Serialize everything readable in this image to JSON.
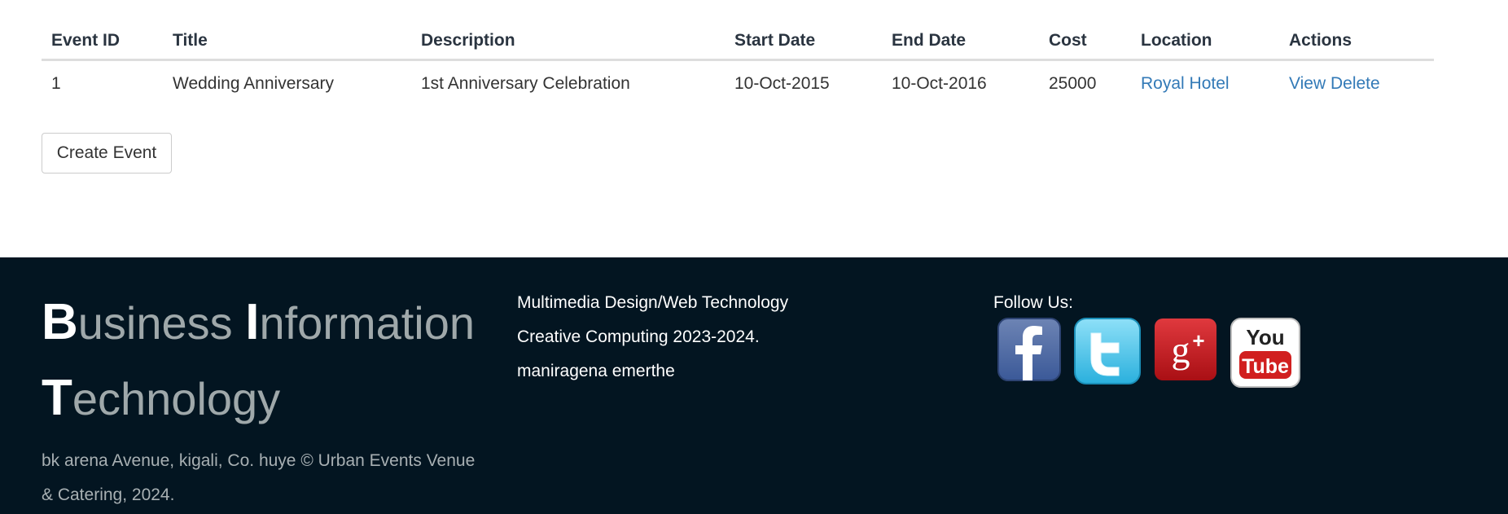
{
  "table": {
    "headers": [
      "Event ID",
      "Title",
      "Description",
      "Start Date",
      "End Date",
      "Cost",
      "Location",
      "Actions"
    ],
    "rows": [
      {
        "id": "1",
        "title": "Wedding Anniversary",
        "description": "1st Anniversary Celebration",
        "start_date": "10-Oct-2015",
        "end_date": "10-Oct-2016",
        "cost": "25000",
        "location": "Royal Hotel",
        "action_view": "View",
        "action_delete": "Delete"
      }
    ]
  },
  "create_button": "Create Event",
  "footer": {
    "brand": {
      "word1_cap": "B",
      "word1_rest": "usiness",
      "word2_cap": "I",
      "word2_rest": "nformation",
      "word3_cap": "T",
      "word3_rest": "echnology"
    },
    "address_line1": "bk arena Avenue, kigali, Co. huye © Urban Events Venue",
    "address_line2": "& Catering, 2024.",
    "course_line1": "Multimedia Design/Web Technology",
    "course_line2": "Creative Computing 2023-2024.",
    "course_line3": "maniragena emerthe",
    "follow_label": "Follow Us:",
    "social": [
      {
        "icon": "facebook-icon",
        "color": "#3b5998",
        "glyph": "f"
      },
      {
        "icon": "twitter-icon",
        "color": "#4fc3e8",
        "glyph": "t"
      },
      {
        "icon": "google-plus-icon",
        "color": "#c4161c",
        "glyph": "g+"
      },
      {
        "icon": "youtube-icon",
        "color": "#d11f1f",
        "glyph_top": "You",
        "glyph_bottom": "Tube"
      }
    ]
  },
  "colors": {
    "footer_bg": "#031521",
    "link": "#337ab7",
    "brand_muted": "#9fa8aa"
  }
}
